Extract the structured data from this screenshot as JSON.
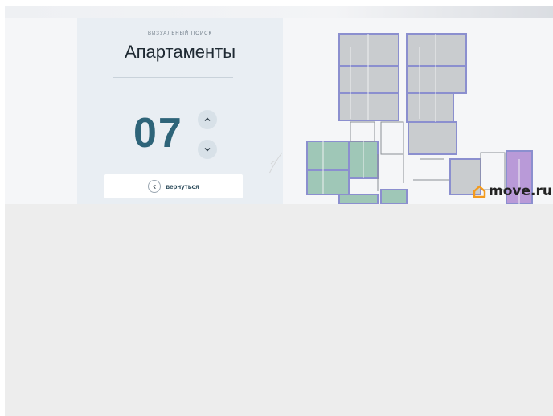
{
  "panel": {
    "overline": "ВИЗУАЛЬНЫЙ ПОИСК",
    "title": "Апартаменты",
    "floor": "07",
    "up_icon": "chevron-up-icon",
    "down_icon": "chevron-down-icon",
    "back_label": "вернуться",
    "back_icon": "chevron-left-icon"
  },
  "watermark": {
    "text": "move.ru",
    "icon": "house-icon",
    "icon_color": "#f39a1e"
  },
  "colors": {
    "accent": "#2e6479",
    "unit_gray": "#c9cccf",
    "unit_green": "#9fc7b7",
    "unit_purple": "#b99ad8",
    "plan_outline": "#8b8fcf"
  }
}
